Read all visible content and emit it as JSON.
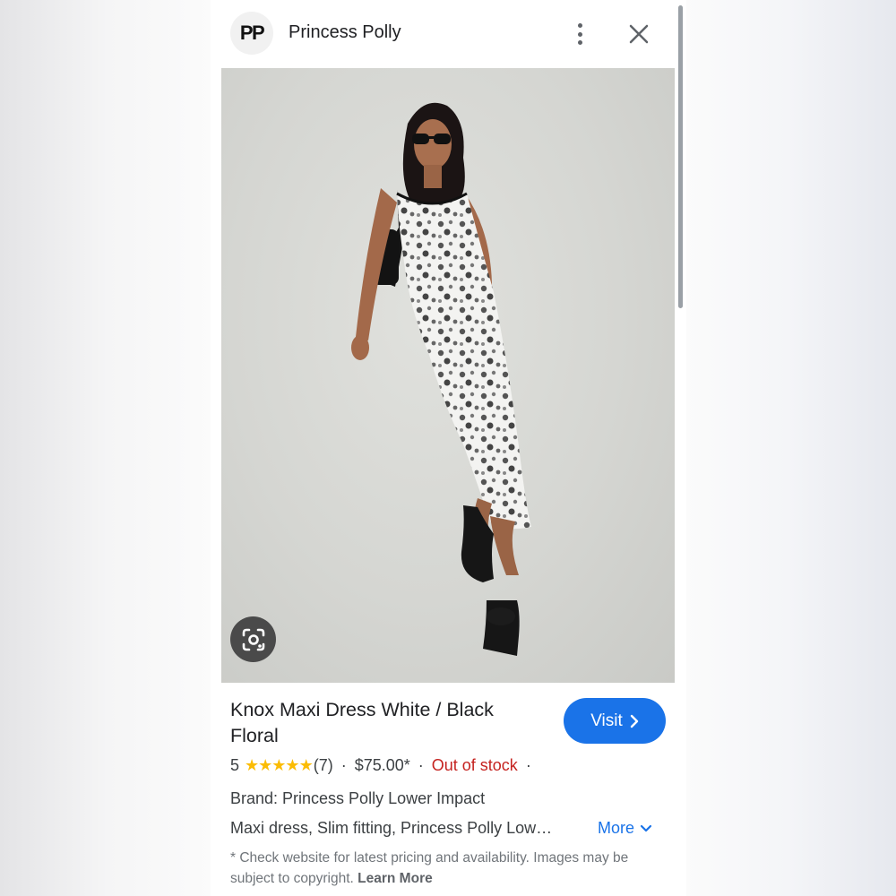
{
  "header": {
    "logo_text": "PP",
    "site_name": "Princess Polly"
  },
  "product": {
    "title": "Knox Maxi Dress White / Black Floral",
    "rating": "5",
    "stars": "★★★★★",
    "review_count": "(7)",
    "separator": "·",
    "price": "$75.00*",
    "stock_status": "Out of stock",
    "brand": "Brand: Princess Polly Lower Impact",
    "description": "Maxi dress, Slim fitting, Princess Polly Low…",
    "more_label": "More"
  },
  "actions": {
    "visit_label": "Visit",
    "visit_chevron": "›"
  },
  "disclaimer": {
    "text": "* Check website for latest pricing and availability. Images may be subject to copyright.",
    "link": "Learn More"
  },
  "colors": {
    "accent_blue": "#1a73e8",
    "out_of_stock_red": "#c5221f",
    "star_yellow": "#fbbc04"
  },
  "icons": [
    "more-vert-icon",
    "close-icon",
    "lens-icon",
    "chevron-right-icon",
    "chevron-down-icon"
  ]
}
